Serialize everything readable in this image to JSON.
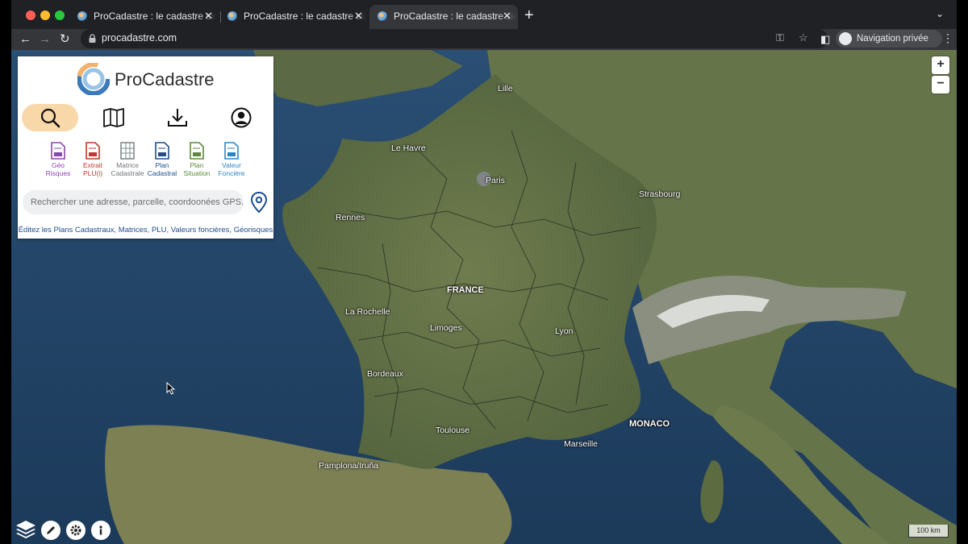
{
  "browser": {
    "tabs": [
      {
        "title": "ProCadastre : le cadastre simplifié",
        "active": false
      },
      {
        "title": "ProCadastre : le cadastre simplifié",
        "active": false
      },
      {
        "title": "ProCadastre : le cadastre simplifié",
        "active": true
      }
    ],
    "url": "procadastre.com",
    "profile_label": "Navigation privée"
  },
  "panel": {
    "brand": "ProCadastre",
    "modes": [
      {
        "name": "search-icon",
        "active": true
      },
      {
        "name": "map-icon",
        "active": false
      },
      {
        "name": "download-icon",
        "active": false
      },
      {
        "name": "user-icon",
        "active": false
      }
    ],
    "tools": [
      {
        "line1": "Géo",
        "line2": "Risques",
        "color": "#8e44ad"
      },
      {
        "line1": "Extrait",
        "line2": "PLU(i)",
        "color": "#c0392b"
      },
      {
        "line1": "Matrice",
        "line2": "Cadastrale",
        "color": "#7f8c8d"
      },
      {
        "line1": "Plan",
        "line2": "Cadastral",
        "color": "#1f4e8c"
      },
      {
        "line1": "Plan",
        "line2": "Situation",
        "color": "#5a8a3a"
      },
      {
        "line1": "Valeur",
        "line2": "Foncière",
        "color": "#2e86c1"
      }
    ],
    "search_placeholder": "Rechercher une adresse, parcelle, coordoonées GPS..",
    "tagline": "Éditez les Plans Cadastraux, Matrices, PLU, Valeurs foncières, Géorisques"
  },
  "map": {
    "labels": {
      "lille": "Lille",
      "le_havre": "Le Havre",
      "paris": "Paris",
      "strasbourg": "Strasbourg",
      "rennes": "Rennes",
      "france": "FRANCE",
      "la_rochelle": "La Rochelle",
      "limoges": "Limoges",
      "lyon": "Lyon",
      "bordeaux": "Bordeaux",
      "monaco": "MONACO",
      "toulouse": "Toulouse",
      "marseille": "Marseille",
      "pamplona": "Pamplona/Iruña"
    },
    "zoom_in": "+",
    "zoom_out": "−",
    "scale": "100 km"
  }
}
